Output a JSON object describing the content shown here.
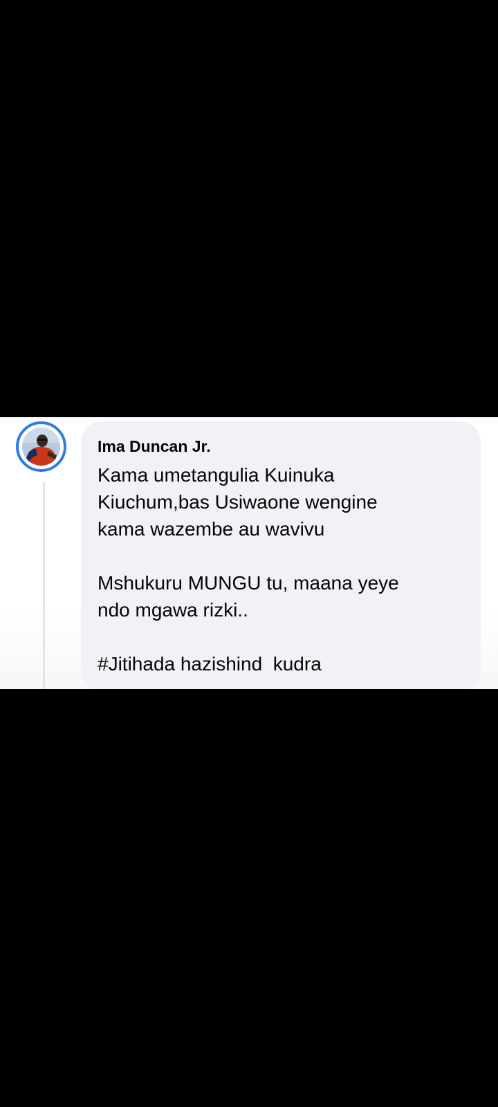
{
  "comment": {
    "author": "Ima Duncan Jr.",
    "lines": [
      "Kama umetangulia Kuinuka",
      "Kiuchum,bas Usiwaone wengine",
      "kama wazembe au wavivu",
      "",
      "Mshukuru MUNGU tu, maana yeye",
      "ndo mgawa rizki..",
      "",
      "#Jitihada hazishind  kudra"
    ]
  },
  "colors": {
    "background": "#000000",
    "bubble": "#f0f2f5",
    "avatar_ring": "#2d7be5",
    "text": "#050505"
  },
  "icons": {
    "avatar": "profile-photo"
  }
}
